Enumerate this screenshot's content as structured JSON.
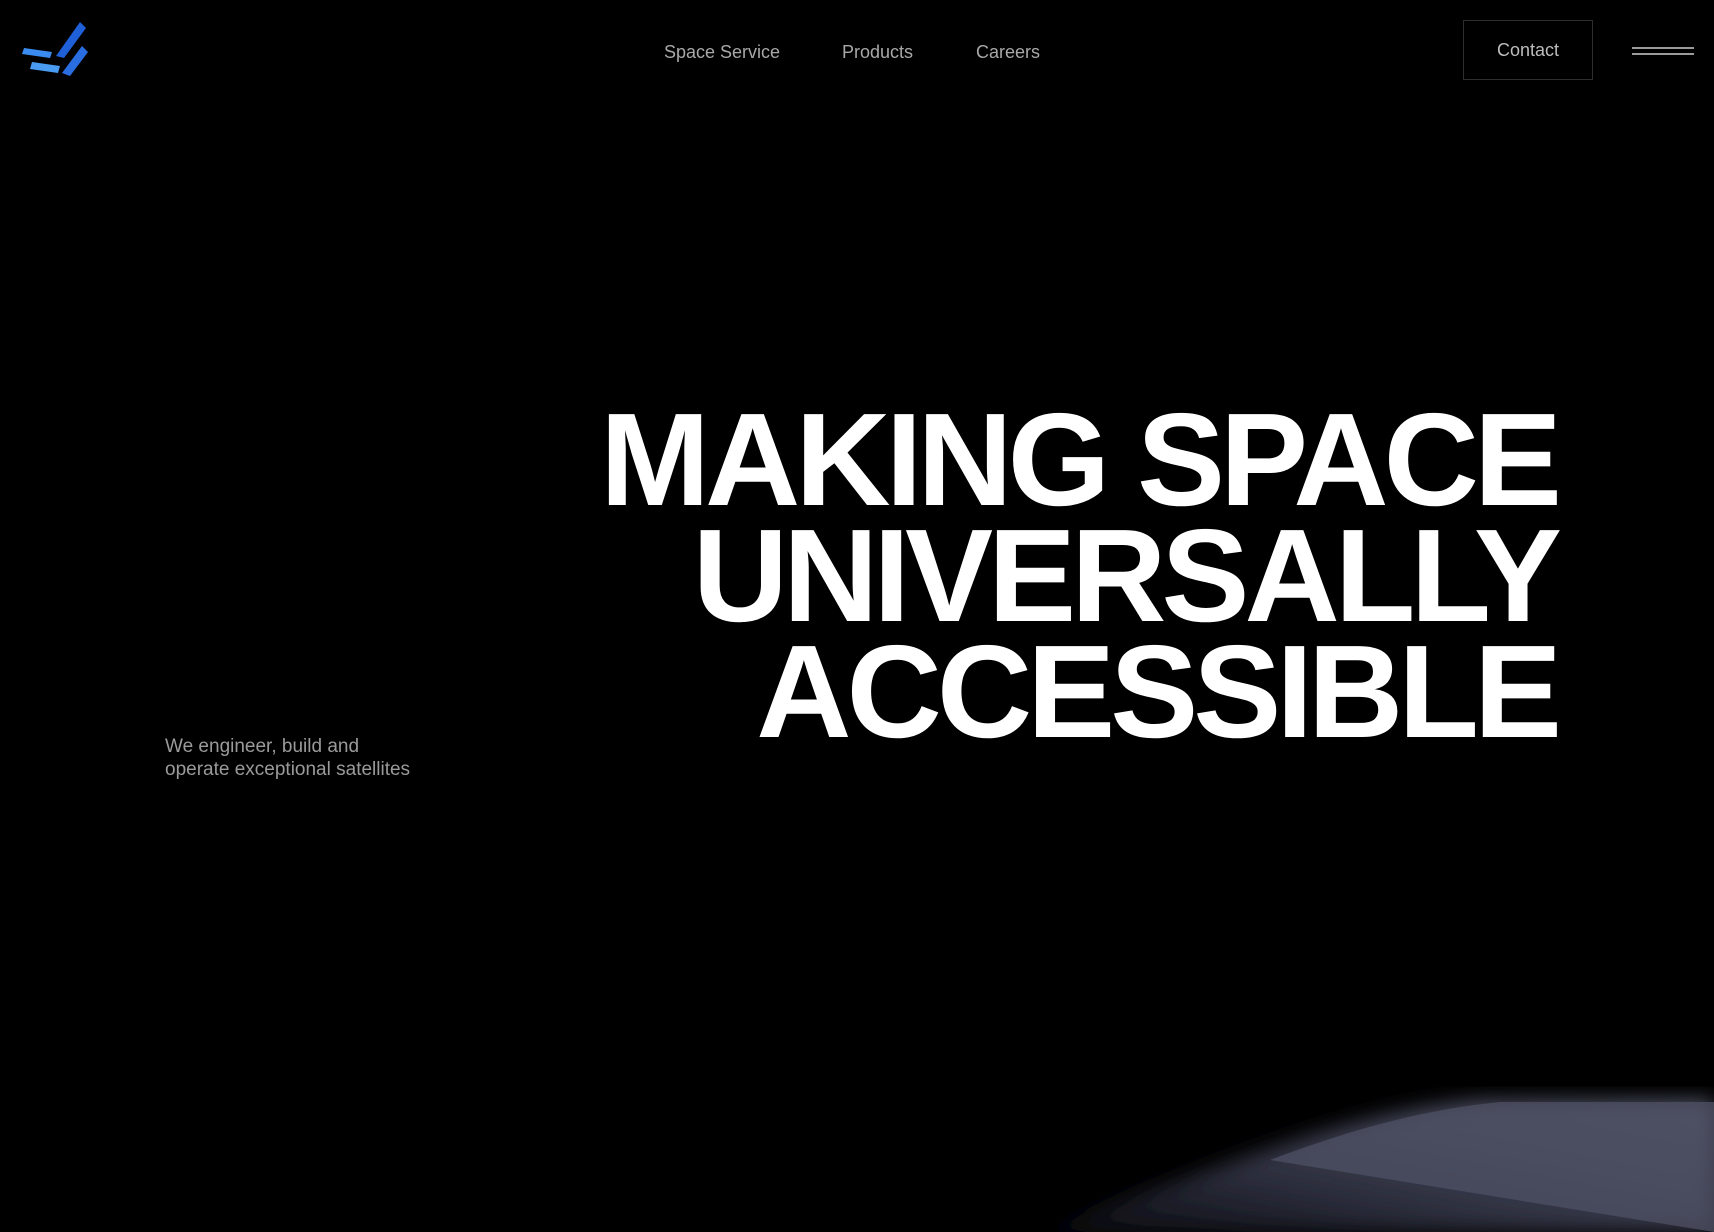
{
  "brand": {
    "logo_icon": "stacked-chevron-logo-icon",
    "logo_colors": [
      "#1f5fd8",
      "#4a9cf2"
    ]
  },
  "nav": {
    "items": [
      {
        "label": "Space Service"
      },
      {
        "label": "Products"
      },
      {
        "label": "Careers"
      }
    ],
    "contact_label": "Contact",
    "menu_icon": "hamburger-menu-icon"
  },
  "hero": {
    "title_lines": [
      "MAKING SPACE",
      "UNIVERSALLY",
      "ACCESSIBLE"
    ],
    "tagline_lines": [
      "We engineer, build and",
      "operate exceptional satellites"
    ]
  },
  "colors": {
    "background": "#000000",
    "title": "#ffffff",
    "nav_text": "#a8a8a8",
    "tagline": "#9a9a9a"
  }
}
